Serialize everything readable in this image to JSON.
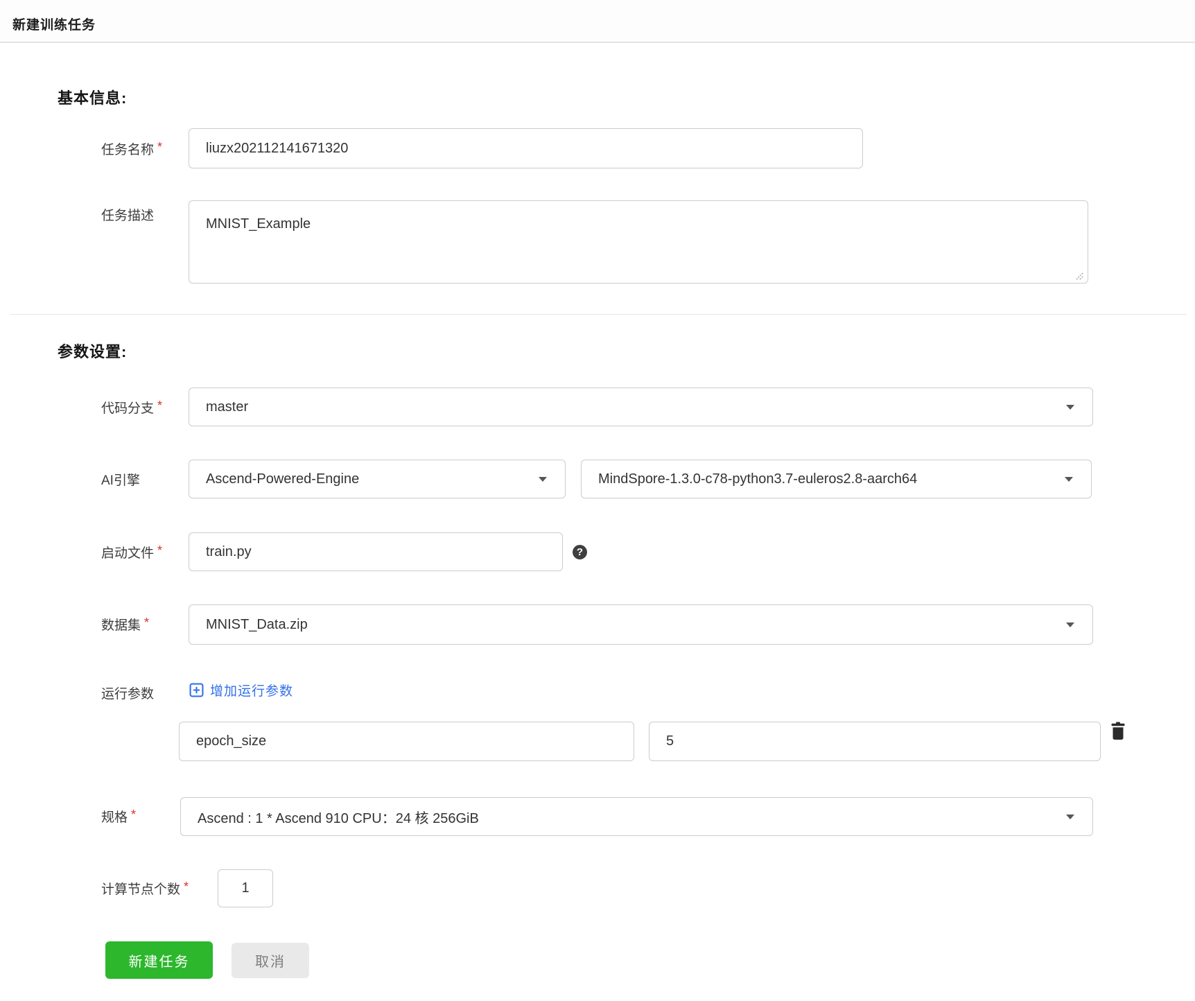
{
  "header": {
    "title": "新建训练任务"
  },
  "sections": {
    "basic_title": "基本信息:",
    "params_title": "参数设置:"
  },
  "marks": {
    "required": "*",
    "help_glyph": "?"
  },
  "fields": {
    "task_name": {
      "label": "任务名称",
      "required": true,
      "value": "liuzx202112141671320"
    },
    "task_desc": {
      "label": "任务描述",
      "required": false,
      "value": "MNIST_Example"
    },
    "code_branch": {
      "label": "代码分支",
      "required": true,
      "value": "master"
    },
    "ai_engine": {
      "label": "AI引擎",
      "required": false,
      "engine": "Ascend-Powered-Engine",
      "version": "MindSpore-1.3.0-c78-python3.7-euleros2.8-aarch64"
    },
    "boot_file": {
      "label": "启动文件",
      "required": true,
      "value": "train.py"
    },
    "dataset": {
      "label": "数据集",
      "required": true,
      "value": "MNIST_Data.zip"
    },
    "run_params": {
      "label": "运行参数",
      "add_label": "增加运行参数",
      "entries": [
        {
          "key": "epoch_size",
          "value": "5"
        }
      ]
    },
    "spec": {
      "label": "规格",
      "required": true,
      "value": "Ascend : 1 * Ascend 910 CPU：24 核 256GiB"
    },
    "node_count": {
      "label": "计算节点个数",
      "required": true,
      "value": "1"
    }
  },
  "buttons": {
    "submit": "新建任务",
    "cancel": "取消"
  },
  "colors": {
    "link_blue": "#3370eb",
    "button_green": "#2cb72c",
    "required_red": "#e02d2d",
    "icon_dark": "#2b2b2b"
  }
}
